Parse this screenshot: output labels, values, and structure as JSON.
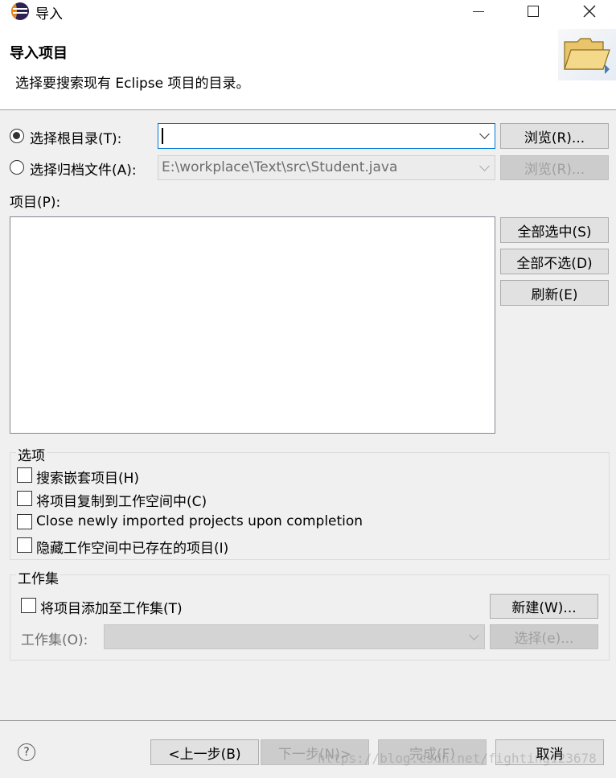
{
  "window": {
    "title": "导入"
  },
  "header": {
    "title": "导入项目",
    "description": "选择要搜索现有 Eclipse 项目的目录。"
  },
  "source": {
    "root_dir_label": "选择根目录(T):",
    "root_dir_value": "",
    "root_browse": "浏览(R)...",
    "archive_label": "选择归档文件(A):",
    "archive_value": "E:\\workplace\\Text\\src\\Student.java",
    "archive_browse": "浏览(R)..."
  },
  "projects": {
    "label": "项目(P):",
    "select_all": "全部选中(S)",
    "deselect_all": "全部不选(D)",
    "refresh": "刷新(E)"
  },
  "options": {
    "title": "选项",
    "items": [
      "搜索嵌套项目(H)",
      "将项目复制到工作空间中(C)",
      "Close newly imported projects upon completion",
      "隐藏工作空间中已存在的项目(I)"
    ]
  },
  "working_set": {
    "title": "工作集",
    "add_label": "将项目添加至工作集(T)",
    "new_button": "新建(W)...",
    "set_label": "工作集(O):",
    "select_button": "选择(e)..."
  },
  "footer": {
    "back": "<上一步(B)",
    "next": "下一步(N)>",
    "finish": "完成(F)",
    "cancel": "取消"
  },
  "watermark": "https://blog.csdn.net/fighting123678"
}
